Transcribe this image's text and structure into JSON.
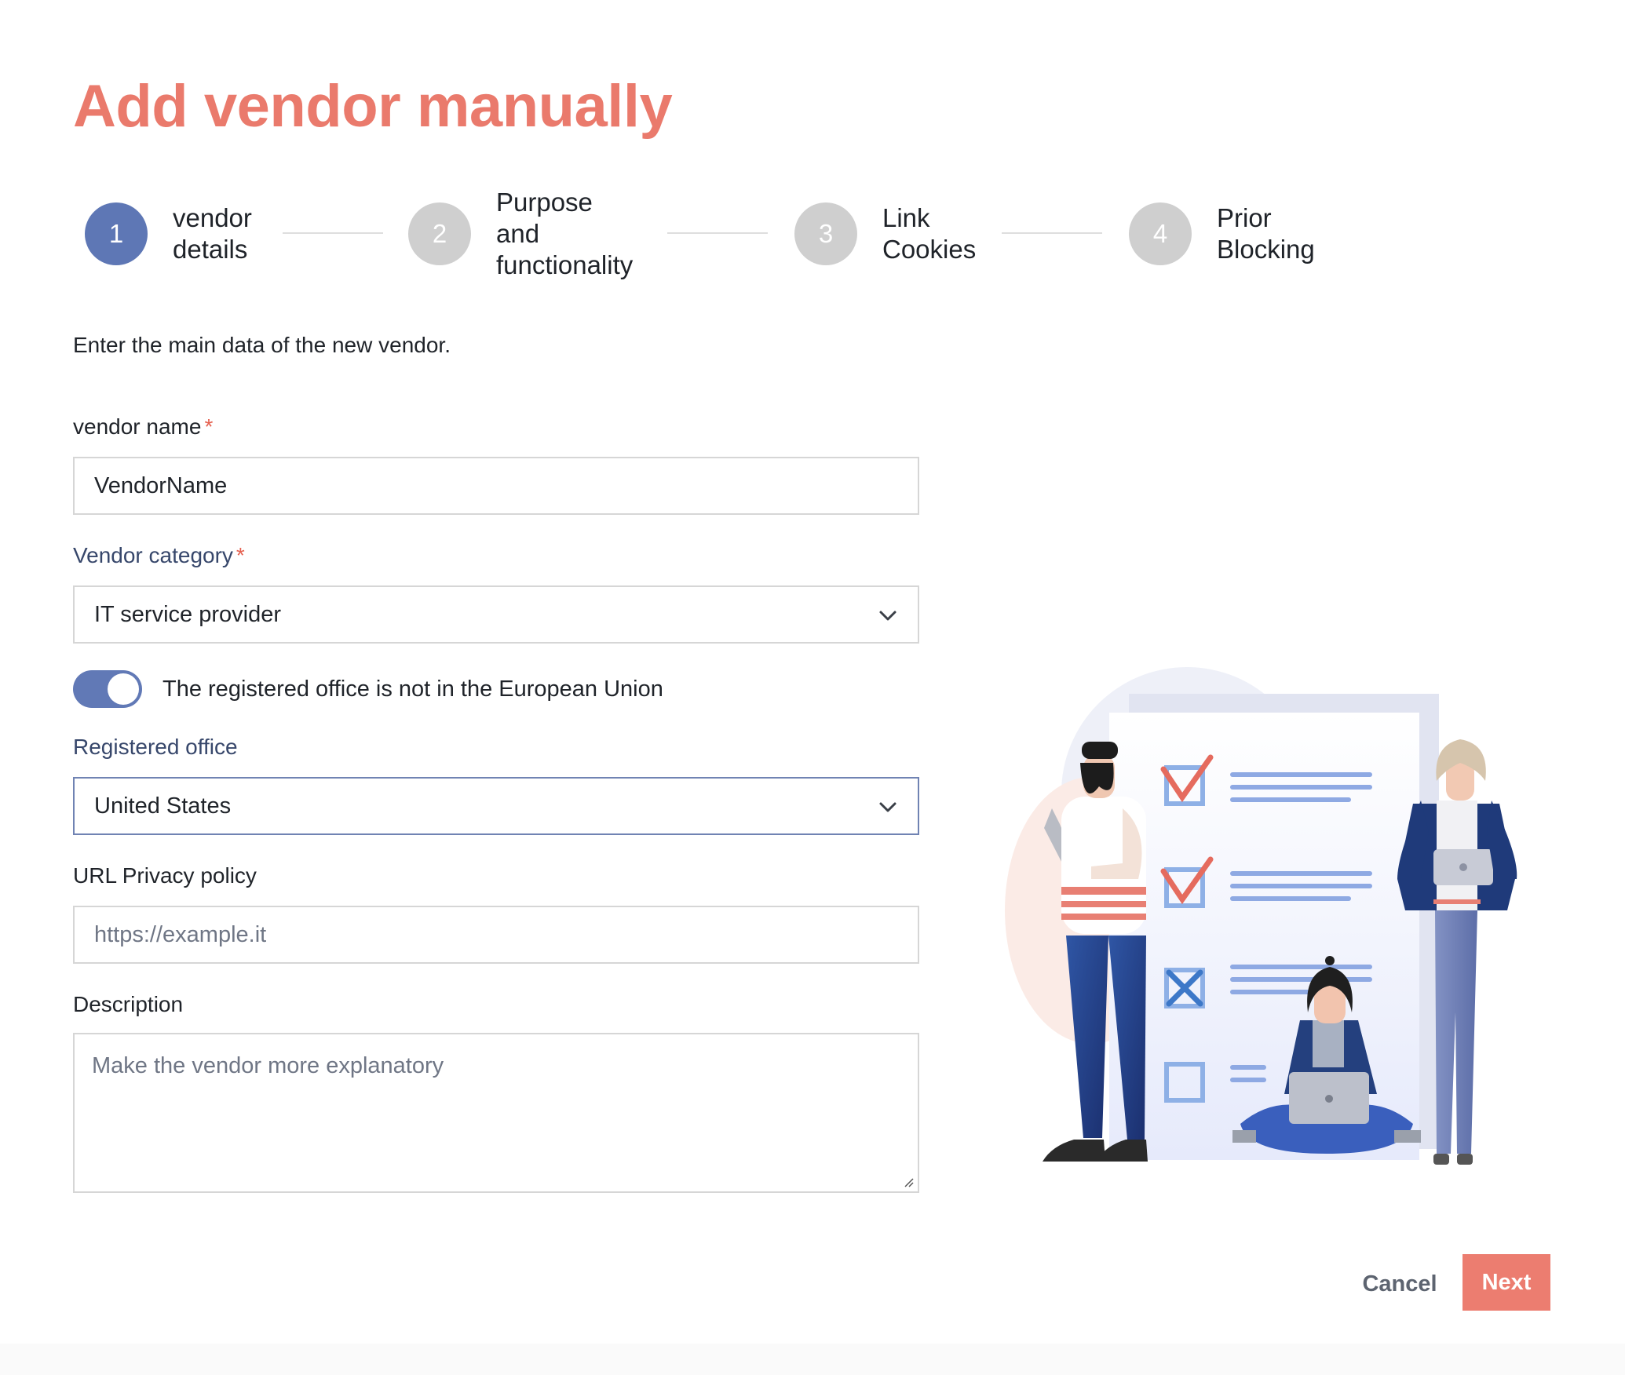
{
  "page": {
    "title": "Add vendor manually",
    "intro": "Enter the main data of the new vendor."
  },
  "stepper": {
    "steps": [
      {
        "number": "1",
        "label": "vendor\ndetails",
        "active": true
      },
      {
        "number": "2",
        "label": "Purpose\nand\nfunctionality",
        "active": false
      },
      {
        "number": "3",
        "label": "Link\nCookies",
        "active": false
      },
      {
        "number": "4",
        "label": "Prior\nBlocking",
        "active": false
      }
    ]
  },
  "form": {
    "vendor_name": {
      "label": "vendor name",
      "required_mark": "*",
      "value": "VendorName"
    },
    "vendor_category": {
      "label": "Vendor category",
      "required_mark": "*",
      "value": "IT service provider"
    },
    "eu_toggle": {
      "label": "The registered office is not in the European Union",
      "on": true
    },
    "registered_office": {
      "label": "Registered office",
      "value": "United States"
    },
    "privacy_url": {
      "label": "URL Privacy policy",
      "placeholder": "https://example.it"
    },
    "description": {
      "label": "Description",
      "placeholder": "Make the vendor more explanatory"
    }
  },
  "actions": {
    "cancel_label": "Cancel",
    "next_label": "Next"
  },
  "colors": {
    "accent": "#ea7a6c",
    "primary": "#5e77b5",
    "step_inactive": "#cfcfcf",
    "required": "#e5604f"
  }
}
